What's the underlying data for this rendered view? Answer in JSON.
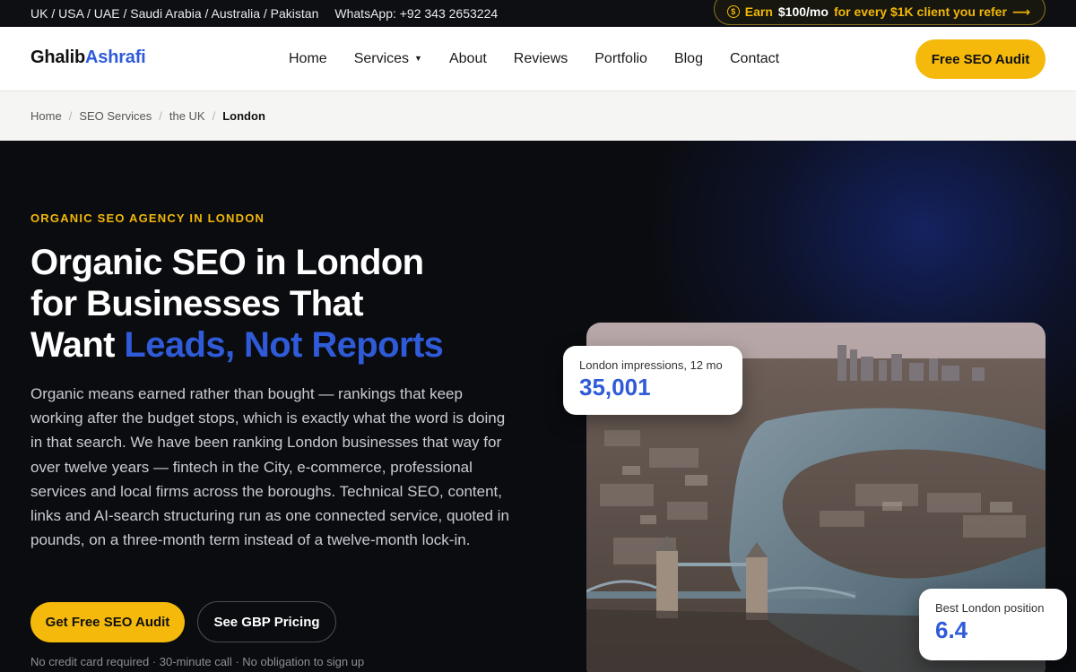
{
  "topbar": {
    "regions": "UK / USA / UAE / Saudi Arabia / Australia / Pakistan",
    "whatsapp": "WhatsApp: +92 343 2653224",
    "promo": {
      "prefix": "Earn",
      "amount": "$100/mo",
      "suffix": "for every $1K client you refer",
      "arrow": "⟶"
    }
  },
  "nav": {
    "logo_first": "Ghalib",
    "logo_second": "Ashrafi",
    "items": [
      "Home",
      "Services",
      "About",
      "Reviews",
      "Portfolio",
      "Blog",
      "Contact"
    ],
    "services_caret": "▼",
    "cta": "Free SEO Audit"
  },
  "breadcrumb": {
    "items": [
      "Home",
      "SEO Services",
      "the UK"
    ],
    "current": "London",
    "separator": "/"
  },
  "hero": {
    "eyebrow": "ORGANIC SEO AGENCY IN LONDON",
    "headline_line1": "Organic SEO in London",
    "headline_line2": "for Businesses That",
    "headline_line3_plain": "Want ",
    "headline_line3_accent": "Leads, Not Reports",
    "body": "Organic means earned rather than bought — rankings that keep working after the budget stops, which is exactly what the word is doing in that search. We have been ranking London businesses that way for over twelve years — fintech in the City, e-commerce, professional services and local firms across the boroughs. Technical SEO, content, links and AI-search structuring run as one connected service, quoted in pounds, on a three-month term instead of a twelve-month lock-in.",
    "primary_cta": "Get Free SEO Audit",
    "secondary_cta": "See GBP Pricing",
    "fineprint": "No credit card required · 30-minute call · No obligation to sign up"
  },
  "stats": {
    "impressions_label": "London impressions, 12 mo",
    "impressions_value": "35,001",
    "position_label": "Best London position",
    "position_value": "6.4"
  },
  "colors": {
    "accent_yellow": "#f4b90b",
    "accent_blue": "#2f5bd8",
    "hero_bg": "#0b0c10"
  },
  "icons": {
    "promo_coin": "coin-icon",
    "promo_arrow": "arrow-right-icon",
    "services_caret": "caret-down-icon"
  }
}
